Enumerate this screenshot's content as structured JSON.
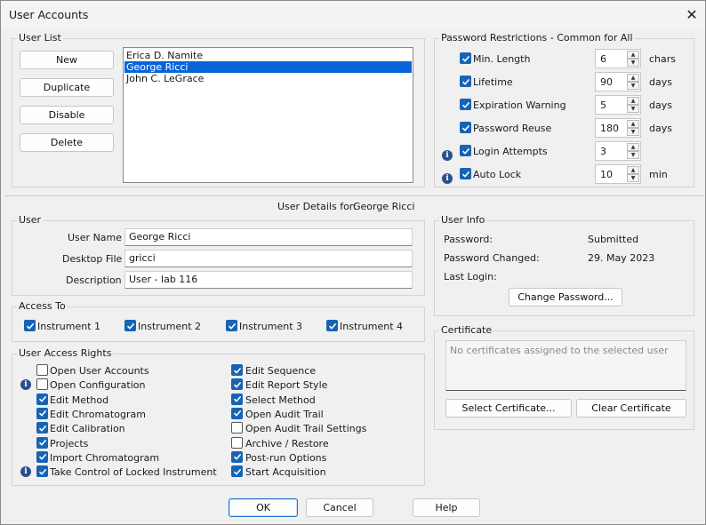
{
  "window": {
    "title": "User Accounts"
  },
  "user_list": {
    "label": "User List",
    "buttons": [
      "New",
      "Duplicate",
      "Disable",
      "Delete"
    ],
    "users": [
      "Erica D. Namite",
      "George Ricci",
      "John C. LeGrace"
    ],
    "selected_index": 1
  },
  "pw": {
    "label": "Password Restrictions - Common for All",
    "rows": [
      {
        "label": "Min. Length",
        "value": "6",
        "unit": "chars",
        "checked": true,
        "info": false
      },
      {
        "label": "Lifetime",
        "value": "90",
        "unit": "days",
        "checked": true,
        "info": false
      },
      {
        "label": "Expiration Warning",
        "value": "5",
        "unit": "days",
        "checked": true,
        "info": false
      },
      {
        "label": "Password Reuse",
        "value": "180",
        "unit": "days",
        "checked": true,
        "info": false
      },
      {
        "label": "Login Attempts",
        "value": "3",
        "unit": "",
        "checked": true,
        "info": true
      },
      {
        "label": "Auto Lock",
        "value": "10",
        "unit": "min",
        "checked": true,
        "info": true
      }
    ]
  },
  "details": {
    "prefix": "User Details for:",
    "name": "George Ricci"
  },
  "user": {
    "label": "User",
    "name_label": "User Name",
    "name": "George Ricci",
    "desktop_label": "Desktop File",
    "desktop": "gricci",
    "desc_label": "Description",
    "desc": "User - lab 116"
  },
  "access": {
    "label": "Access To",
    "items": [
      {
        "label": "Instrument 1",
        "checked": true
      },
      {
        "label": "Instrument 2",
        "checked": true
      },
      {
        "label": "Instrument 3",
        "checked": true
      },
      {
        "label": "Instrument 4",
        "checked": true
      }
    ]
  },
  "rights": {
    "label": "User Access Rights",
    "left": [
      {
        "label": "Open User Accounts",
        "checked": false,
        "info": false
      },
      {
        "label": "Open Configuration",
        "checked": false,
        "info": true
      },
      {
        "label": "Edit Method",
        "checked": true,
        "info": false
      },
      {
        "label": "Edit Chromatogram",
        "checked": true,
        "info": false
      },
      {
        "label": "Edit Calibration",
        "checked": true,
        "info": false
      },
      {
        "label": "Projects",
        "checked": true,
        "info": false
      },
      {
        "label": "Import Chromatogram",
        "checked": true,
        "info": false
      },
      {
        "label": "Take Control of Locked Instrument",
        "checked": true,
        "info": true
      }
    ],
    "right": [
      {
        "label": "Edit Sequence",
        "checked": true
      },
      {
        "label": "Edit Report Style",
        "checked": true
      },
      {
        "label": "Select Method",
        "checked": true
      },
      {
        "label": "Open Audit Trail",
        "checked": true
      },
      {
        "label": "Open Audit Trail Settings",
        "checked": false
      },
      {
        "label": "Archive / Restore",
        "checked": false
      },
      {
        "label": "Post-run Options",
        "checked": true
      },
      {
        "label": "Start Acquisition",
        "checked": true
      }
    ]
  },
  "info": {
    "label": "User Info",
    "password_label": "Password:",
    "password": "Submitted",
    "changed_label": "Password Changed:",
    "changed": "29. May 2023",
    "last_login_label": "Last Login:",
    "last_login": "",
    "change_button": "Change Password..."
  },
  "cert": {
    "label": "Certificate",
    "empty": "No certificates assigned to the selected user",
    "select_button": "Select Certificate...",
    "clear_button": "Clear Certificate"
  },
  "footer": {
    "ok": "OK",
    "cancel": "Cancel",
    "help": "Help"
  }
}
